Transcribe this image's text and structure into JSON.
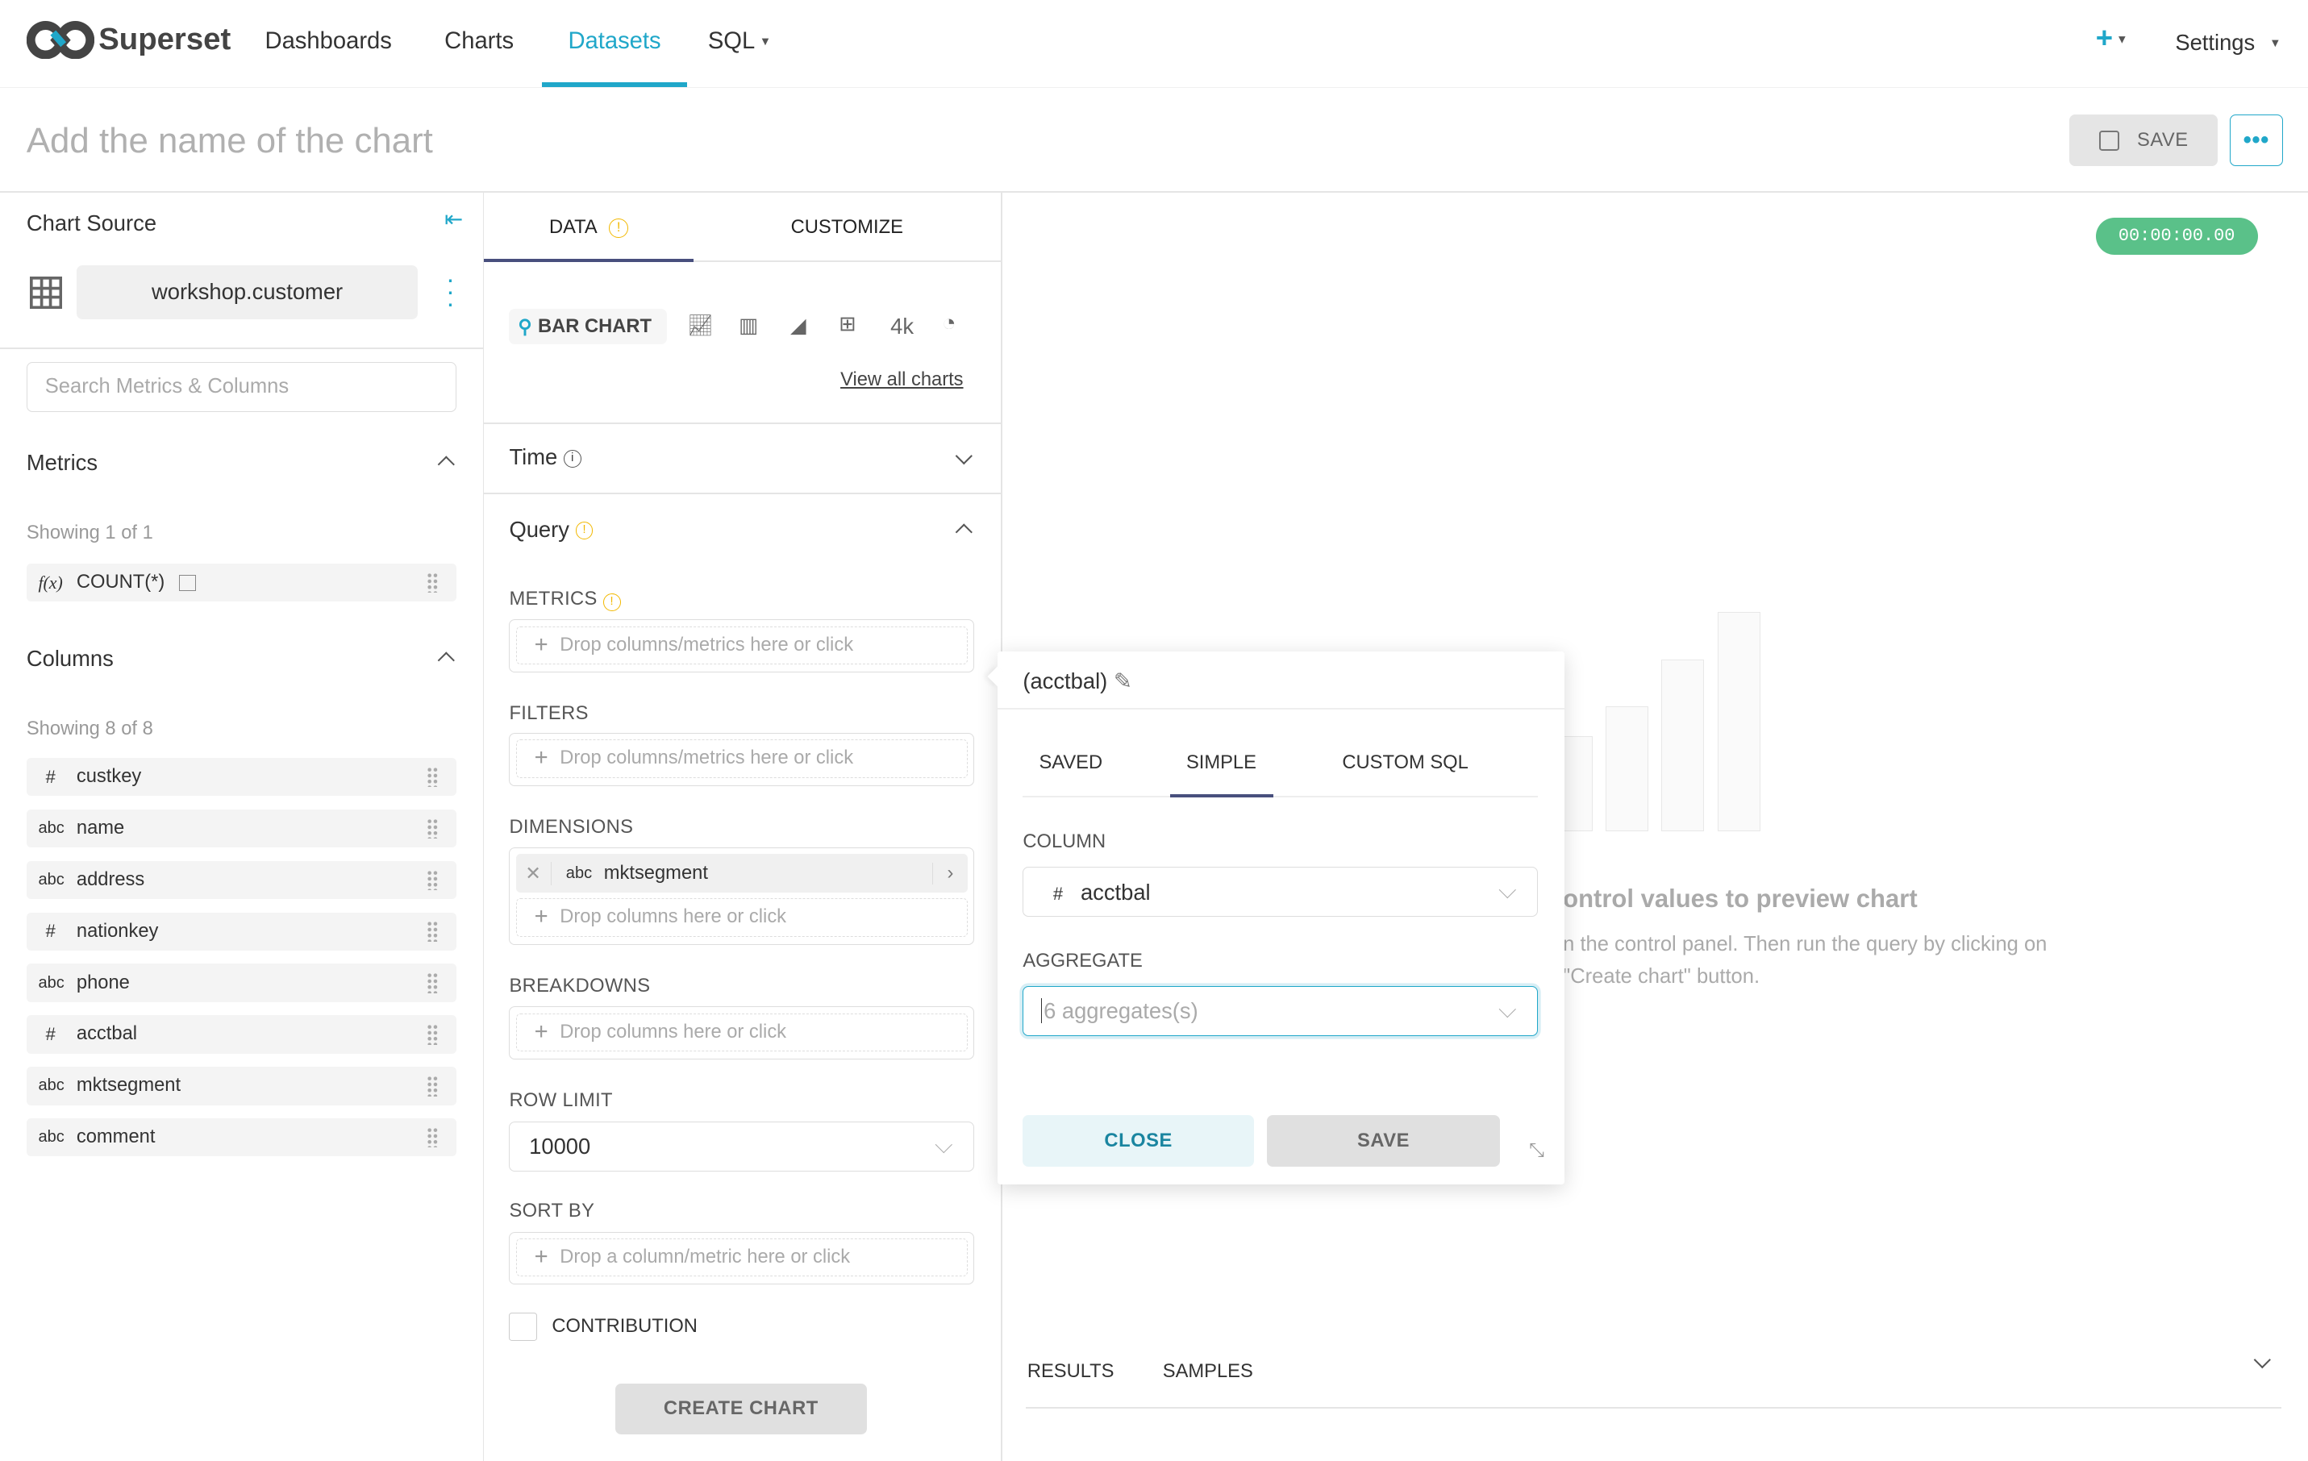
{
  "header": {
    "brand": "Superset",
    "nav": [
      "Dashboards",
      "Charts",
      "Datasets",
      "SQL"
    ],
    "active_nav": "Datasets",
    "settings": "Settings",
    "accent": "#20a7c9"
  },
  "title_bar": {
    "chart_name_placeholder": "Add the name of the chart",
    "save_label": "SAVE"
  },
  "source": {
    "title": "Chart Source",
    "dataset": "workshop.customer",
    "search_placeholder": "Search Metrics & Columns",
    "metrics_title": "Metrics",
    "metrics_showing": "Showing 1 of 1",
    "metrics": [
      {
        "type": "f(x)",
        "name": "COUNT(*)"
      }
    ],
    "columns_title": "Columns",
    "columns_showing": "Showing 8 of 8",
    "columns": [
      {
        "type": "#",
        "name": "custkey"
      },
      {
        "type": "abc",
        "name": "name"
      },
      {
        "type": "abc",
        "name": "address"
      },
      {
        "type": "#",
        "name": "nationkey"
      },
      {
        "type": "abc",
        "name": "phone"
      },
      {
        "type": "#",
        "name": "acctbal"
      },
      {
        "type": "abc",
        "name": "mktsegment"
      },
      {
        "type": "abc",
        "name": "comment"
      }
    ]
  },
  "control": {
    "tabs": [
      "DATA",
      "CUSTOMIZE"
    ],
    "active_tab": "DATA",
    "viz_type": "BAR CHART",
    "view_all": "View all charts",
    "big_number": "4k",
    "time_label": "Time",
    "query_label": "Query",
    "metrics_label": "METRICS",
    "metrics_drop": "Drop columns/metrics here or click",
    "filters_label": "FILTERS",
    "filters_drop": "Drop columns/metrics here or click",
    "dimensions_label": "DIMENSIONS",
    "dimension_type": "abc",
    "dimension_value": "mktsegment",
    "dimensions_drop": "Drop columns here or click",
    "breakdowns_label": "BREAKDOWNS",
    "breakdowns_drop": "Drop columns here or click",
    "row_limit_label": "ROW LIMIT",
    "row_limit_value": "10000",
    "sort_by_label": "SORT BY",
    "sort_by_drop": "Drop a column/metric here or click",
    "contribution_label": "CONTRIBUTION",
    "contribution_checked": false,
    "create_chart": "CREATE CHART"
  },
  "chart_area": {
    "timer": "00:00:00.00",
    "empty_title": "ontrol values to preview chart",
    "empty_line1": "n the control panel. Then run the query by clicking on",
    "empty_line2": "\"Create chart\" button.",
    "bottom_tabs": [
      "RESULTS",
      "SAMPLES"
    ]
  },
  "popover": {
    "title": "(acctbal)",
    "tabs": [
      "SAVED",
      "SIMPLE",
      "CUSTOM SQL"
    ],
    "active_tab": "SIMPLE",
    "column_label": "COLUMN",
    "column_type": "#",
    "column_value": "acctbal",
    "aggregate_label": "AGGREGATE",
    "aggregate_placeholder": "6 aggregates(s)",
    "close": "CLOSE",
    "save": "SAVE"
  }
}
